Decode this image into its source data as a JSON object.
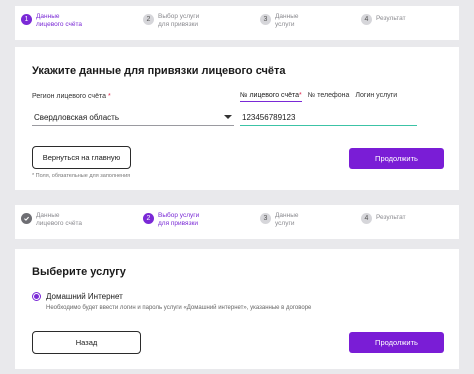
{
  "stepper1": {
    "steps": [
      {
        "num": "1",
        "label": "Данные\nлицевого счёта",
        "state": "active"
      },
      {
        "num": "2",
        "label": "Выбор услуги\nдля привязки",
        "state": "todo"
      },
      {
        "num": "3",
        "label": "Данные\nуслуги",
        "state": "todo"
      },
      {
        "num": "4",
        "label": "Результат",
        "state": "todo"
      }
    ]
  },
  "account_form": {
    "title": "Укажите данные для привязки лицевого счёта",
    "region_label": "Регион лицевого счёта",
    "required_mark": "*",
    "region_value": "Свердловская область",
    "tabs": [
      {
        "label": "№ лицевого счёта",
        "required": true
      },
      {
        "label": "№ телефона"
      },
      {
        "label": "Логин услуги"
      }
    ],
    "account_value": "123456789123",
    "back_button": "Вернуться на главную",
    "continue_button": "Продолжить",
    "required_note": "* Поля, обязательные для заполнения"
  },
  "stepper2": {
    "steps": [
      {
        "num": "1",
        "label": "Данные\nлицевого счёта",
        "state": "done"
      },
      {
        "num": "2",
        "label": "Выбор услуги\nдля привязки",
        "state": "active"
      },
      {
        "num": "3",
        "label": "Данные\nуслуги",
        "state": "todo"
      },
      {
        "num": "4",
        "label": "Результат",
        "state": "todo"
      }
    ]
  },
  "service_form": {
    "title": "Выберите услугу",
    "option_label": "Домашний Интернет",
    "option_desc": "Необходимо будет ввести логин и пароль услуги «Домашний интернет», указанные в договоре",
    "back_button": "Назад",
    "continue_button": "Продолжить"
  },
  "colors": {
    "accent": "#7a1dd6",
    "input_focus": "#3cc3a6",
    "required": "#e0244c"
  }
}
